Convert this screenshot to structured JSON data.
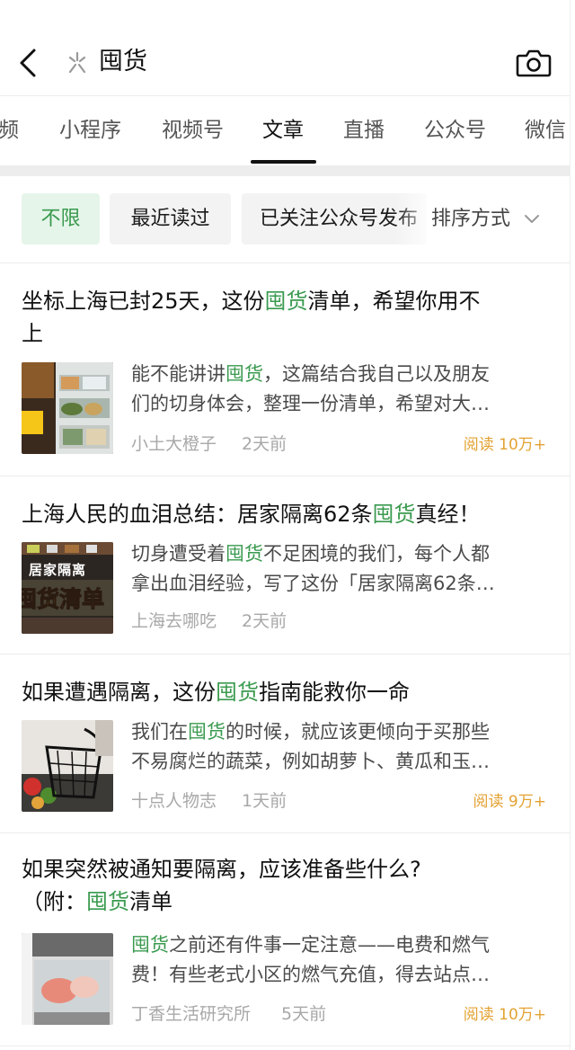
{
  "header": {
    "query": "囤货",
    "back_icon": "chevron-left-icon",
    "search_icon": "asterisk-search-icon",
    "camera_icon": "camera-icon"
  },
  "tabs": [
    {
      "label": "频",
      "active": false
    },
    {
      "label": "小程序",
      "active": false
    },
    {
      "label": "视频号",
      "active": false
    },
    {
      "label": "文章",
      "active": true
    },
    {
      "label": "直播",
      "active": false
    },
    {
      "label": "公众号",
      "active": false
    },
    {
      "label": "微信",
      "active": false
    }
  ],
  "filters": {
    "chips": [
      {
        "label": "不限",
        "active": true
      },
      {
        "label": "最近读过",
        "active": false
      },
      {
        "label": "已关注公众号发布",
        "active": false
      }
    ],
    "sort_label": "排序方式"
  },
  "colors": {
    "highlight": "#3a9a4f",
    "reads": "#e3a233",
    "meta": "#a8a8a8"
  },
  "articles": [
    {
      "title_line1": [
        "坐标上海已封25天，这份",
        "囤货",
        "清单，希望你用不"
      ],
      "title_line2": "上",
      "snippet_line1": [
        "能不能讲讲",
        "囤货",
        "，这篇结合我自己以及朋友"
      ],
      "snippet_line2": "们的切身体会，整理一份清单，希望对大…",
      "source": "小土大橙子",
      "time": "2天前",
      "reads": "阅读 10万+"
    },
    {
      "title_line1": [
        "上海人民的血泪总结：居家隔离62条",
        "囤货",
        "真经！"
      ],
      "snippet_line1": [
        "切身遭受着",
        "囤货",
        "不足困境的我们，每个人都"
      ],
      "snippet_line2": "拿出血泪经验，写了这份「居家隔离62条…",
      "source": "上海去哪吃",
      "time": "2天前",
      "reads": "",
      "thumb_text1": "居家隔离",
      "thumb_text2": "囤货清单"
    },
    {
      "title_line1": [
        "如果遭遇隔离，这份",
        "囤货",
        "指南能救你一命"
      ],
      "snippet_line1": [
        "我们在",
        "囤货",
        "的时候，就应该更倾向于买那些"
      ],
      "snippet_line2": "不易腐烂的蔬菜，例如胡萝卜、黄瓜和玉…",
      "source": "十点人物志",
      "time": "1天前",
      "reads": "阅读 9万+"
    },
    {
      "title_line1": [
        "如果突然被通知要隔离，应该准备些什么?",
        "",
        ""
      ],
      "title_line2_parts": [
        "（附：",
        "囤货",
        "清单"
      ],
      "snippet_line1": [
        "",
        "囤货",
        "之前还有件事一定注意——电费和燃气"
      ],
      "snippet_line2": "费！有些老式小区的燃气充值，得去站点…",
      "source": "丁香生活研究所",
      "time": "5天前",
      "reads": "阅读 10万+"
    }
  ]
}
